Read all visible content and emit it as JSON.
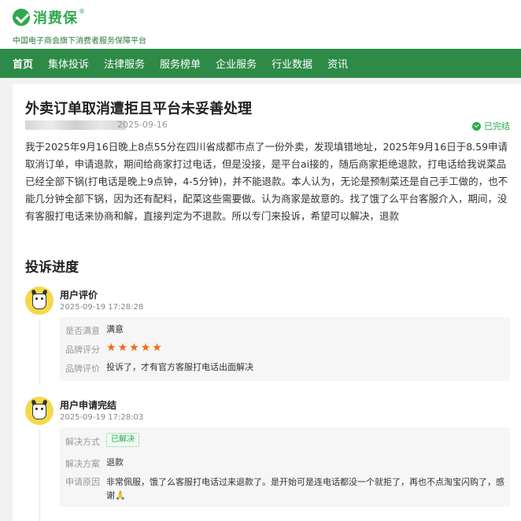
{
  "header": {
    "brand": "消费保",
    "brand_mark": "®",
    "tagline": "中国电子商会旗下消费者服务保障平台"
  },
  "nav": {
    "items": [
      "首页",
      "集体投诉",
      "法律服务",
      "服务榜单",
      "企业服务",
      "行业数据",
      "资讯"
    ],
    "active_index": 0
  },
  "complaint": {
    "title": "外卖订单取消遭拒且平台未妥善处理",
    "date": "2025-09-16",
    "status": "已完结",
    "body": "我于2025年9月16日晚上8点55分在四川省成都市点了一份外卖，发现填错地址，2025年9月16日于8.59申请取消订单，申请退款，期间给商家打过电话，但是没接，是平台ai接的，随后商家拒绝退款，打电话给我说菜品已经全部下锅(打电话是晚上9点钟，4-5分钟)，并不能退款。本人认为，无论是预制菜还是自己手工做的，也不能几分钟全部下锅，因为还有配料，配菜这些需要做。认为商家是故意的。找了饿了么平台客服介入，期间，没有客服打电话来协商和解，直接判定为不退款。所以专门来投诉，希望可以解决，退款"
  },
  "progress": {
    "title": "投诉进度",
    "entries": [
      {
        "name": "用户评价",
        "time": "2025-09-19 17:28:28",
        "rows": {
          "satisfied_label": "是否满意",
          "satisfied_value": "满意",
          "rating_label": "品牌评分",
          "rating_stars": 5,
          "comment_label": "品牌评价",
          "comment_value": "投诉了，才有官方客服打电话出面解决"
        }
      },
      {
        "name": "用户申请完结",
        "time": "2025-09-19 17:28:03",
        "rows": {
          "method_label": "解决方式",
          "method_value": "已解决",
          "plan_label": "解决方案",
          "plan_value": "退款",
          "reason_label": "申请原因",
          "reason_value": "非常佩服，饿了么客服打电话过来退款了。是开始可是连电话都没一个就拒了，再也不点淘宝闪购了，感谢🙏"
        }
      }
    ]
  },
  "colors": {
    "brand_green": "#2fa84f",
    "nav_green": "#2e8b47",
    "star_orange": "#f06a1b"
  },
  "icons": {
    "logo": "shield-check-icon",
    "status": "check-circle-icon",
    "avatar": "cartoon-cow-avatar-icon",
    "star": "star-icon"
  }
}
